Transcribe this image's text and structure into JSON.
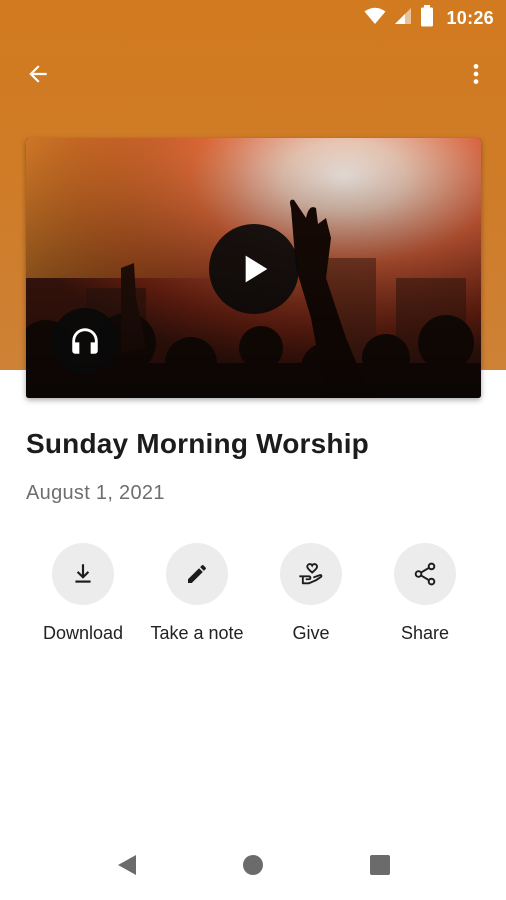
{
  "status_bar": {
    "time": "10:26",
    "icons": [
      "wifi-icon",
      "signal-icon",
      "battery-icon"
    ]
  },
  "app_bar": {
    "back_icon": "arrow-back-icon",
    "menu_icon": "more-vert-icon"
  },
  "media": {
    "play_icon": "play-icon",
    "audio_icon": "headphones-icon"
  },
  "sermon": {
    "title": "Sunday Morning Worship",
    "date": "August 1, 2021"
  },
  "actions": [
    {
      "label": "Download",
      "icon": "download-icon"
    },
    {
      "label": "Take a note",
      "icon": "pencil-icon"
    },
    {
      "label": "Give",
      "icon": "give-hand-heart-icon"
    },
    {
      "label": "Share",
      "icon": "share-icon"
    }
  ],
  "colors": {
    "header": "#d17a1f",
    "action_bg": "#ececec",
    "title": "#1c1c1c",
    "date": "#6e6e6e"
  }
}
